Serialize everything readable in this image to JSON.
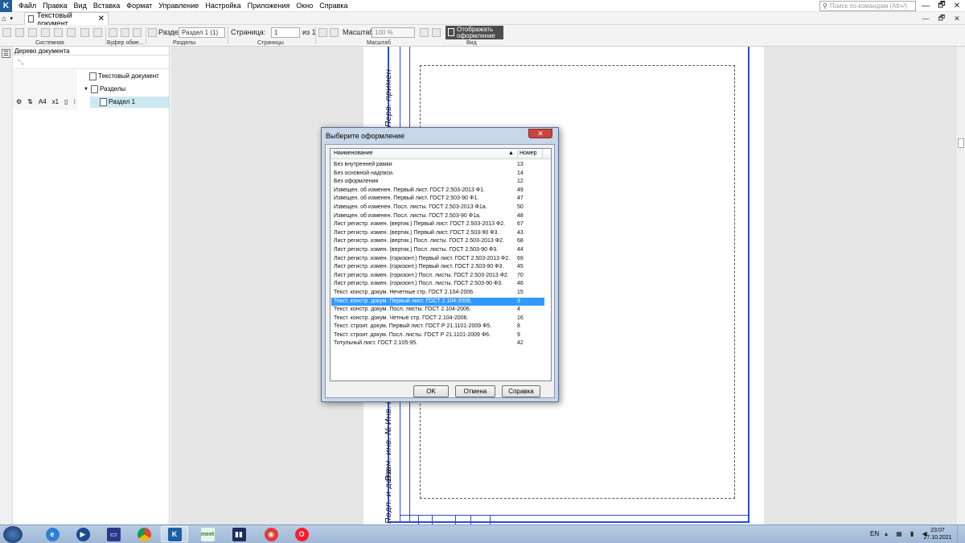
{
  "menubar": {
    "logo": "K",
    "items": [
      "Файл",
      "Правка",
      "Вид",
      "Вставка",
      "Формат",
      "Управление",
      "Настройка",
      "Приложения",
      "Окно",
      "Справка"
    ],
    "search_placeholder": "Поиск по командам (Alt+/)",
    "minimize": "—",
    "restore": "🗗",
    "close": "✕"
  },
  "tabs": {
    "home_icon": "⌂",
    "active_tab": "Текстовый документ…",
    "close": "✕"
  },
  "toolbar": {
    "section_label": "Раздел",
    "section_value": "Раздел 1 (1)",
    "page_label": "Страница:",
    "page_value": "1",
    "page_of": "из 1",
    "zoom_label": "Масштаб:",
    "zoom_value": "100 %",
    "show_design": "Отображать оформление",
    "groups": [
      "Системная",
      "Буфер обме...",
      "Разделы",
      "Страницы",
      "Масштаб",
      "Вид"
    ]
  },
  "tree": {
    "title": "Дерево документа",
    "root": "Текстовый документ",
    "sections_node": "Разделы",
    "section_item": "Раздел 1",
    "tools": [
      "A4",
      "x1"
    ]
  },
  "sheet": {
    "vertical_labels": [
      "Перв. примен",
      "Инв. №",
      "Взам. инв. №",
      "Подп. и дата"
    ]
  },
  "dialog": {
    "title": "Выберите оформление",
    "col_name": "Наименование",
    "col_number": "Номер",
    "items": [
      {
        "name": "Без внутренней рамки",
        "num": "13"
      },
      {
        "name": "Без основной надписи.",
        "num": "14"
      },
      {
        "name": "Без оформления",
        "num": "12"
      },
      {
        "name": "Извещен. об изменен. Первый лист. ГОСТ 2.503-2013 Ф1.",
        "num": "49"
      },
      {
        "name": "Извещен. об изменен. Первый лист. ГОСТ 2.503-90 Ф1.",
        "num": "47"
      },
      {
        "name": "Извещен. об изменен. Посл. листы. ГОСТ 2.503-2013 Ф1а.",
        "num": "50"
      },
      {
        "name": "Извещен. об изменен. Посл. листы. ГОСТ 2.503-90 Ф1а.",
        "num": "48"
      },
      {
        "name": "Лист регистр. измен. (вертик.) Первый лист. ГОСТ 2.503-2013 Ф2.",
        "num": "67"
      },
      {
        "name": "Лист регистр. измен. (вертик.) Первый лист. ГОСТ 2.503-90 Ф3.",
        "num": "43"
      },
      {
        "name": "Лист регистр. измен. (вертик.) Посл. листы. ГОСТ 2.503-2013 Ф2.",
        "num": "68"
      },
      {
        "name": "Лист регистр. измен. (вертик.) Посл. листы. ГОСТ 2.503-90 Ф3.",
        "num": "44"
      },
      {
        "name": "Лист регистр. измен. (горизонт.) Первый лист. ГОСТ 2.503-2013 Ф2.",
        "num": "69"
      },
      {
        "name": "Лист регистр. измен. (горизонт.) Первый лист. ГОСТ 2.503-90 Ф3.",
        "num": "45"
      },
      {
        "name": "Лист регистр. измен. (горизонт.) Посл. листы. ГОСТ 2.503-2013 Ф2.",
        "num": "70"
      },
      {
        "name": "Лист регистр. измен. (горизонт.) Посл. листы. ГОСТ 2.503-90 Ф3.",
        "num": "46"
      },
      {
        "name": "Текст. констр. докум. Нечетные стр. ГОСТ 2.104-2006.",
        "num": "15"
      },
      {
        "name": "Текст. констр. докум. Первый лист. ГОСТ 2.104-2006.",
        "num": "3"
      },
      {
        "name": "Текст. констр. докум. Посл. листы. ГОСТ 2.104-2006.",
        "num": "4"
      },
      {
        "name": "Текст. констр. докум. Четные стр. ГОСТ 2.104-2006.",
        "num": "16"
      },
      {
        "name": "Текст. строит. докум. Первый лист. ГОСТ Р 21.1101-2009 Ф5.",
        "num": "8"
      },
      {
        "name": "Текст. строит. докум. Посл. листы. ГОСТ Р 21.1101-2009 Ф6.",
        "num": "9"
      },
      {
        "name": "Титульный лист. ГОСТ 2.105-95.",
        "num": "42"
      }
    ],
    "selected_index": 16,
    "ok": "OK",
    "cancel": "Отмена",
    "help": "Справка"
  },
  "taskbar": {
    "apps": [
      "ie",
      "media-player",
      "save",
      "chrome",
      "kompas",
      "meet",
      "terminal",
      "antivirus",
      "opera"
    ],
    "meet_label": "meet",
    "lang": "EN",
    "time": "23:07",
    "date": "27.10.2021"
  }
}
